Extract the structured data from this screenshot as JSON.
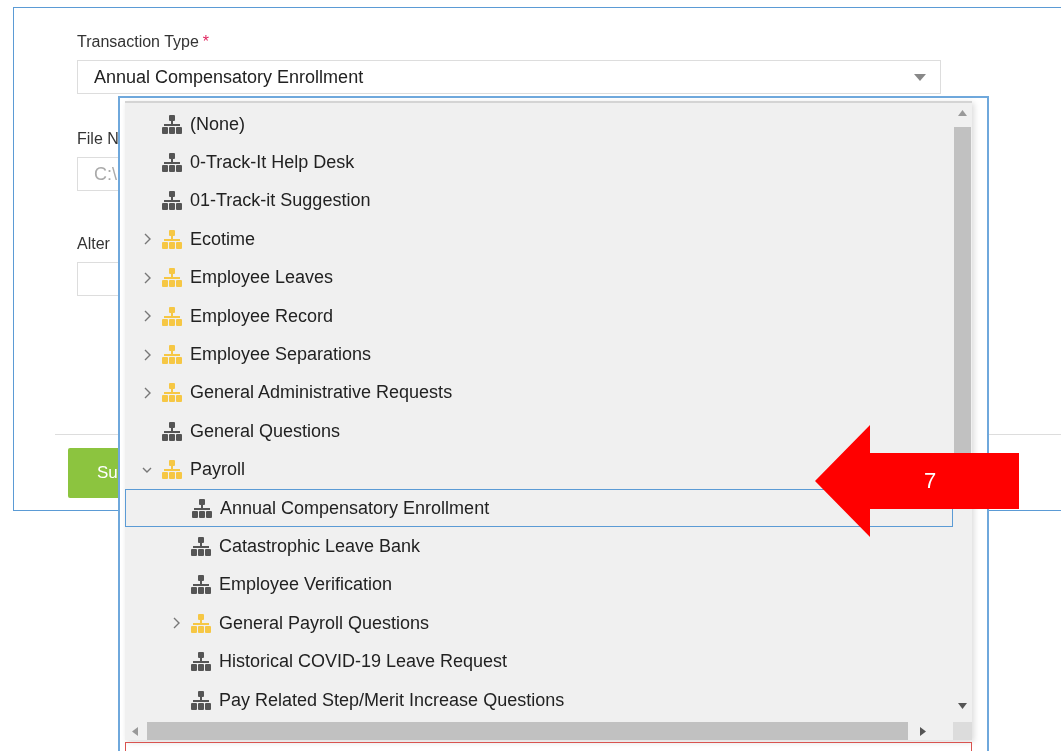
{
  "form": {
    "transaction_type": {
      "label": "Transaction Type",
      "required_mark": "*",
      "value": "Annual Compensatory Enrollment"
    },
    "file_name": {
      "label": "File N",
      "value": "C:\\"
    },
    "alternate": {
      "label": "Alter"
    },
    "submit_button": "Su"
  },
  "dropdown": {
    "items": [
      {
        "kind": "leaf",
        "label": "(None)",
        "selected": false
      },
      {
        "kind": "leaf",
        "label": "0-Track-It Help Desk",
        "selected": false
      },
      {
        "kind": "leaf",
        "label": "01-Track-it Suggestion",
        "selected": false
      },
      {
        "kind": "folder",
        "label": "Ecotime",
        "expanded": false,
        "selected": false
      },
      {
        "kind": "folder",
        "label": "Employee Leaves",
        "expanded": false,
        "selected": false
      },
      {
        "kind": "folder",
        "label": "Employee Record",
        "expanded": false,
        "selected": false
      },
      {
        "kind": "folder",
        "label": "Employee Separations",
        "expanded": false,
        "selected": false
      },
      {
        "kind": "folder",
        "label": "General Administrative Requests",
        "expanded": false,
        "selected": false
      },
      {
        "kind": "leaf",
        "label": "General Questions",
        "selected": false
      },
      {
        "kind": "folder",
        "label": "Payroll",
        "expanded": true,
        "selected": false,
        "children": [
          {
            "kind": "leaf",
            "label": "Annual Compensatory Enrollment",
            "selected": true
          },
          {
            "kind": "leaf",
            "label": "Catastrophic Leave Bank",
            "selected": false
          },
          {
            "kind": "leaf",
            "label": "Employee Verification",
            "selected": false
          },
          {
            "kind": "folder",
            "label": "General Payroll Questions",
            "expanded": false,
            "selected": false
          },
          {
            "kind": "leaf",
            "label": "Historical COVID-19 Leave Request",
            "selected": false
          },
          {
            "kind": "leaf",
            "label": "Pay Related Step/Merit Increase Questions",
            "selected": false
          }
        ]
      }
    ]
  },
  "callout": {
    "label": "7"
  }
}
